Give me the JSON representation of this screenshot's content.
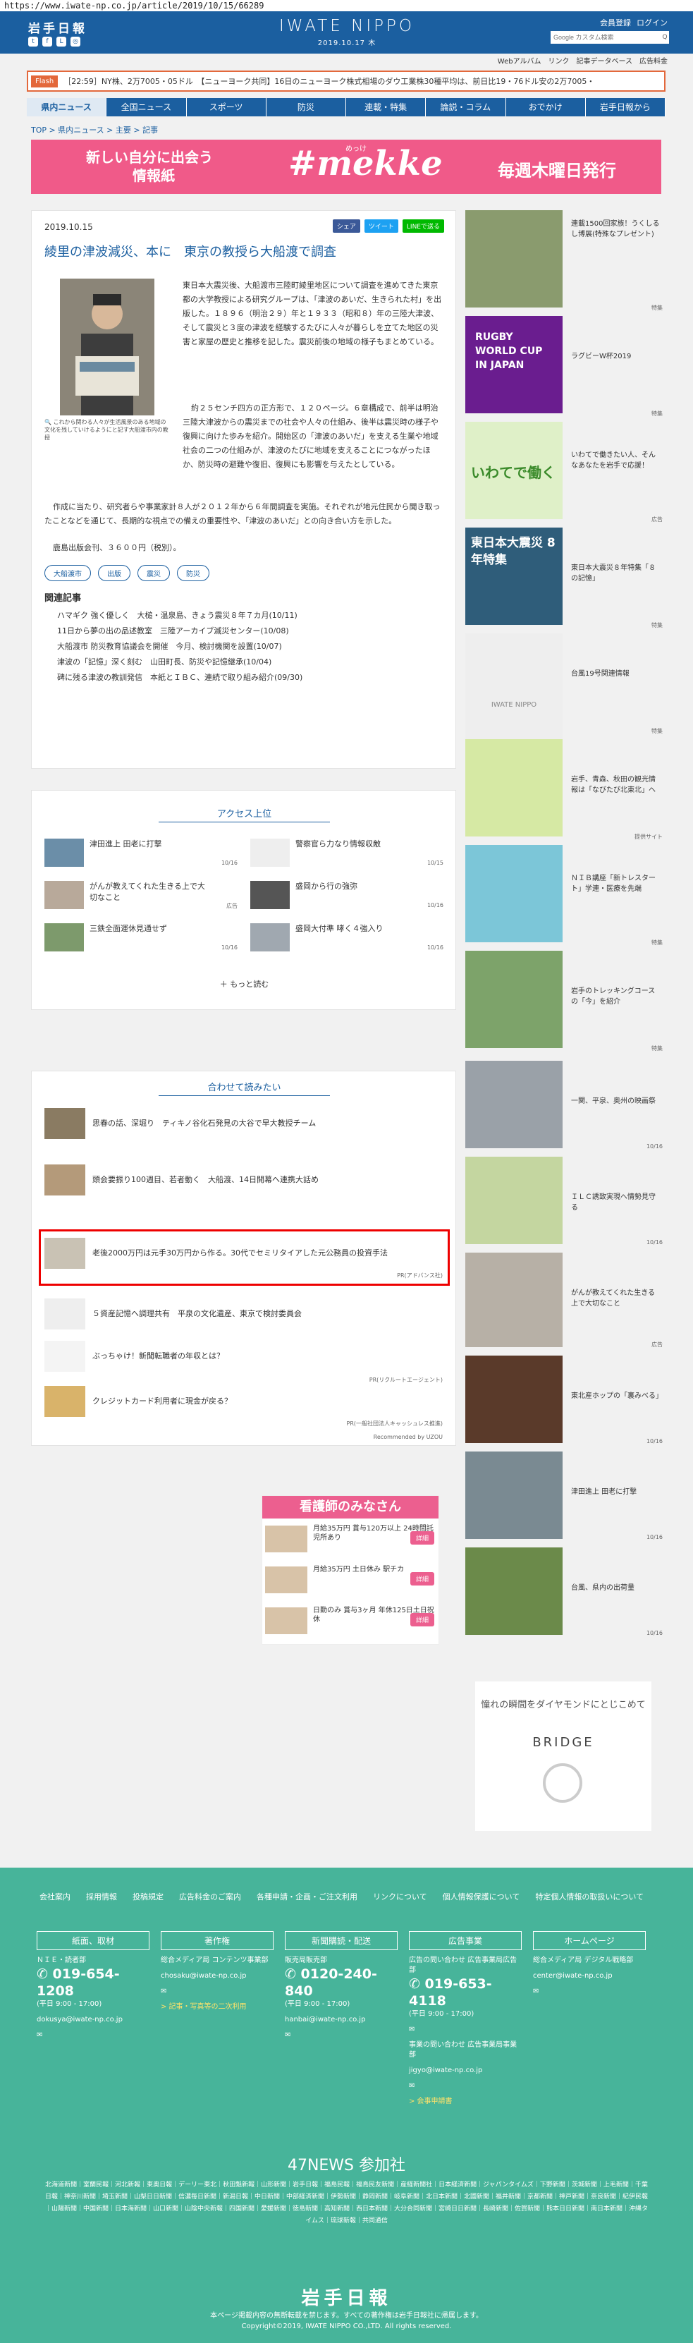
{
  "url": "https://www.iwate-np.co.jp/article/2019/10/15/66289",
  "header": {
    "logo_jp": "岩手日報",
    "logo_en": "IWATE NIPPO",
    "date": "2019.10.17 木",
    "links": [
      "会員登録",
      "ログイン"
    ],
    "search_placeholder": "Google カスタム検索",
    "search_button": "Q",
    "sublinks": [
      "Webアルバム",
      "リンク",
      "記事データベース",
      "広告料金"
    ]
  },
  "flash": {
    "label": "Flash",
    "text": "［22:59］NY株、2万7005・05ドル　【ニューヨーク共同】16日のニューヨーク株式相場のダウ工業株30種平均は、前日比19・76ドル安の2万7005・"
  },
  "nav": [
    "県内ニュース",
    "全国ニュース",
    "スポーツ",
    "防災",
    "連載・特集",
    "論説・コラム",
    "おでかけ",
    "岩手日報から"
  ],
  "breadcrumb": "TOP > 県内ニュース > 主要 > 記事",
  "banner": {
    "line1": "新しい自分に出会う",
    "line2": "情報紙",
    "brand": "#mekke",
    "brand_ruby": "めっけ",
    "right": "毎週木曜日発行"
  },
  "article": {
    "date": "2019.10.15",
    "share": [
      "シェア",
      "ツイート",
      "LINEで送る"
    ],
    "title": "綾里の津波減災、本に　東京の教授ら大船渡で調査",
    "caption": "これから関わる人々が生活風景のある地域の文化を残していけるようにと記す大船渡市内の教授",
    "paragraphs": [
      "東日本大震災後、大船渡市三陸町綾里地区について調査を進めてきた東京都の大学教授による研究グループは、「津波のあいだ、生きられた村」を出版した。１８９６（明治２９）年と１９３３（昭和８）年の三陸大津波、そして震災と３度の津波を経験するたびに人々が暮らしを立てた地区の災害と家屋の歴史と推移を記した。震災前後の地域の様子もまとめている。",
      "約２５センチ四方の正方形で、１２０ページ。６章構成で、前半は明治三陸大津波からの震災までの社会や人々の仕組み、後半は震災時の様子や復興に向けた歩みを紹介。開始区の「津波のあいだ」を支える生業や地域社会の二つの仕組みが、津波のたびに地域を支えることにつながったほか、防災時の避難や復旧、復興にも影響を与えたとしている。",
      "作成に当たり、研究者らや事業家計８人が２０１２年から６年間調査を実施。それぞれが地元住民から聞き取ったことなどを通じて、長期的な視点での備えの重要性や、「津波のあいだ」との向き合い方を示した。",
      "鹿島出版会刊、３６００円（税別）。"
    ],
    "tags": [
      "大船渡市",
      "出版",
      "震災",
      "防災"
    ],
    "related_title": "関連記事",
    "related": [
      "ハマギク 強く優しく　大槌・温泉島、きょう震災８年７カ月(10/11)",
      "11日から夢の出の品述教室　三陸アーカイブ滅災センター(10/08)",
      "大船渡市 防災教育協議会を開催　今月、検討機関を設置(10/07)",
      "津波の「記憶」深く刻む　山田町長、防災や記憶継承(10/04)",
      "碑に残る津波の教訓発信　本紙とＩＢＣ、連続で取り組み紹介(09/30)"
    ]
  },
  "access": {
    "title": "アクセス上位",
    "items": [
      {
        "text": "津田進上 田老に打撃",
        "date": "10/16"
      },
      {
        "text": "警察官ら力なり情報収敵",
        "date": "10/15"
      },
      {
        "text": "がんが教えてくれた生きる上で大切なこと",
        "date": "広告"
      },
      {
        "text": "盛岡から行の強弥",
        "date": "10/16"
      },
      {
        "text": "三鉄全面運休見通せず",
        "date": "10/16"
      },
      {
        "text": "盛岡大付準 哮く４強入り",
        "date": "10/16"
      }
    ],
    "more": "もっと読む"
  },
  "readtoo": {
    "title": "合わせて読みたい",
    "items": [
      {
        "text": "思春の話、深堀り　ティキノ谷化石発見の大谷で早大教授チーム",
        "pr": ""
      },
      {
        "text": "頭会要振り100週目、若者動く　大船渡、14日開幕へ連携大話め",
        "pr": ""
      },
      {
        "text": "老後2000万円は元手30万円から作る。30代でセミリタイアした元公務員の投資手法",
        "pr": "PR(アドバンス社)"
      },
      {
        "text": "５資産記憶へ調理共有　平泉の文化遺産、東京で検討委員会",
        "pr": ""
      },
      {
        "text": "ぶっちゃけ！新聞転職者の年収とは？",
        "pr": "PR(リクルートエージェント)"
      },
      {
        "text": "クレジットカード利用者に現金が戻る？",
        "pr": "PR(一般社団法人キャッシュレス推進)"
      }
    ],
    "recommend": "Recommended by UZOU"
  },
  "ad": {
    "title": "看護師のみなさん",
    "rows": [
      {
        "text": "月給35万円 賞与120万以上 24時間託児所あり",
        "btn": "詳細"
      },
      {
        "text": "月給35万円 土日休み 駅チカ",
        "btn": "詳細"
      },
      {
        "text": "日勤のみ 賞与3ヶ月 年休125日土日祝休",
        "btn": "詳細"
      }
    ]
  },
  "sidebar": [
    {
      "text": "連載1500回家族！うくしるし博展(特殊なプレゼント)",
      "label": "特集"
    },
    {
      "text": "ラグビーW杯2019",
      "label": "特集",
      "img": "RUGBY WORLD CUP IN JAPAN"
    },
    {
      "text": "いわてで働きたい人、そんなあなたを岩手で応援！",
      "label": "広告",
      "img": "いわてで働く"
    },
    {
      "text": "東日本大震災８年特集「８の記憶」",
      "label": "特集",
      "img": "東日本大震災 8年特集"
    },
    {
      "text": "台風19号関連情報",
      "label": "特集",
      "img": "IWATE NIPPO"
    },
    {
      "text": "岩手、青森、秋田の観光情報は「なびたび北東北」へ",
      "label": "提供サイト"
    },
    {
      "text": "ＮＩＢ講座「新トレスタート」学連・医療を先端",
      "label": "特集"
    },
    {
      "text": "岩手のトレッキングコースの「今」を紹介",
      "label": "特集"
    },
    {
      "text": "一関、平泉、奥州の映画祭",
      "label": "10/16"
    },
    {
      "text": "ＩＬＣ誘致実現へ情勢見守る",
      "label": "10/16"
    },
    {
      "text": "がんが教えてくれた生きる上で大切なこと",
      "label": "広告"
    },
    {
      "text": "東北産ホップの「裏みべる」",
      "label": "10/16"
    },
    {
      "text": "津田進上 田老に打撃",
      "label": "10/16"
    },
    {
      "text": "台風、県内の出荷量",
      "label": "10/16"
    },
    {
      "text": "憧れの瞬間をダイヤモンドにとじこめて",
      "label": "BRIDGE"
    }
  ],
  "footer": {
    "links": [
      "会社案内",
      "採用情報",
      "投稿規定",
      "広告料金のご案内",
      "各種申請・企画・ご注文利用",
      "リンクについて",
      "個人情報保護について",
      "特定個人情報の取扱いについて"
    ],
    "cols": [
      {
        "h": "紙面、取材",
        "sub": "ＮＩＥ・読者部",
        "tel": "019-654-1208",
        "hours": "(平日 9:00 - 17:00)",
        "mail": "dokusya@iwate-np.co.jp"
      },
      {
        "h": "著作権",
        "sub": "総合メディア局 コンテンツ事業部",
        "tel": "",
        "hours": "",
        "mail": "chosaku@iwate-np.co.jp",
        "note": "> 記事・写真等の二次利用"
      },
      {
        "h": "新聞購読・配送",
        "sub": "販売局販売部",
        "tel": "0120-240-840",
        "hours": "(平日 9:00 - 17:00)",
        "mail": "hanbai@iwate-np.co.jp"
      },
      {
        "h": "広告事業",
        "sub": "広告の問い合わせ 広告事業局広告部",
        "tel": "019-653-4118",
        "hours": "(平日 9:00 - 17:00)",
        "mail": "jigyo@iwate-np.co.jp",
        "note": "> 会事申請書",
        "sub2": "事業の問い合わせ 広告事業局事業部"
      },
      {
        "h": "ホームページ",
        "sub": "総合メディア局 デジタル戦略部",
        "tel": "",
        "hours": "",
        "mail": "center@iwate-np.co.jp"
      }
    ],
    "n47": "47NEWS 参加社",
    "n47list": "北海道新聞｜室蘭民報｜河北新報｜東奥日報｜デーリー東北｜秋田魁新報｜山形新聞｜岩手日報｜福島民報｜福島民友新聞｜産経新聞社｜日本経済新聞｜ジャパンタイムズ｜下野新聞｜茨城新聞｜上毛新聞｜千葉日報｜神奈川新聞｜埼玉新聞｜山梨日日新聞｜信濃毎日新聞｜新潟日報｜中日新聞｜中部経済新聞｜伊勢新聞｜静岡新聞｜岐阜新聞｜北日本新聞｜北國新聞｜福井新聞｜京都新聞｜神戸新聞｜奈良新聞｜紀伊民報｜山陽新聞｜中国新聞｜日本海新聞｜山口新聞｜山陰中央新報｜四国新聞｜愛媛新聞｜徳島新聞｜高知新聞｜西日本新聞｜大分合同新聞｜宮崎日日新聞｜長崎新聞｜佐賀新聞｜熊本日日新聞｜南日本新聞｜沖縄タイムス｜琉球新報｜共同通信",
    "logo": "岩手日報",
    "copy1": "本ページ掲載内容の無断転載を禁じます。すべての著作権は岩手日報社に帰属します。",
    "copy2": "Copyright©2019, IWATE NIPPO CO.,LTD. All rights reserved."
  }
}
